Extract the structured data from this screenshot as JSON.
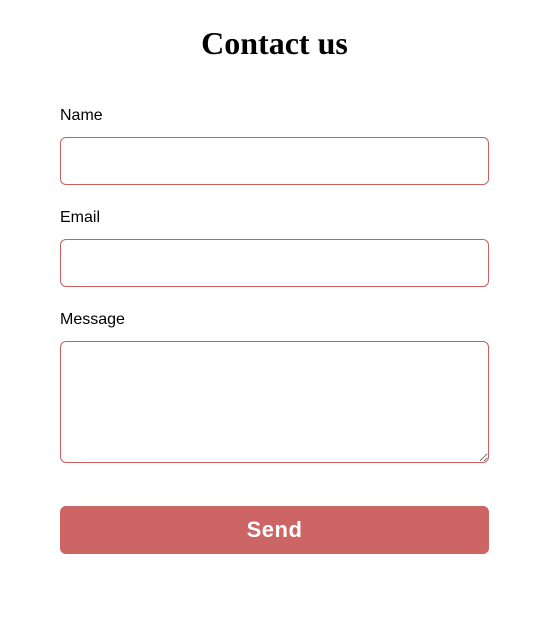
{
  "title": "Contact us",
  "form": {
    "name": {
      "label": "Name",
      "value": ""
    },
    "email": {
      "label": "Email",
      "value": ""
    },
    "message": {
      "label": "Message",
      "value": ""
    },
    "submit_label": "Send"
  },
  "colors": {
    "accent": "#cd6565",
    "border": "#cb5f5f"
  }
}
